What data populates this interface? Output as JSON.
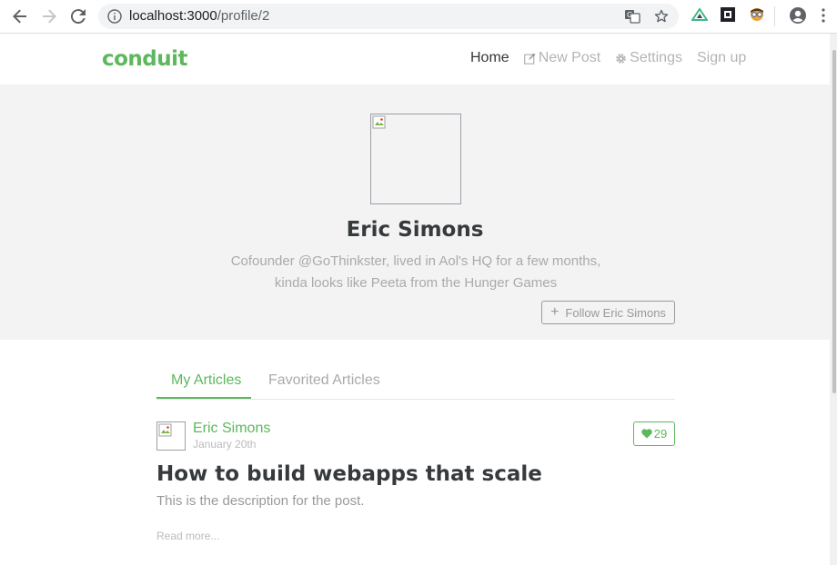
{
  "browser": {
    "url_host": "localhost:3000",
    "url_path": "/profile/2"
  },
  "navbar": {
    "brand": "conduit",
    "links": [
      {
        "label": "Home",
        "icon": ""
      },
      {
        "label": "New Post",
        "icon": "edit-icon"
      },
      {
        "label": "Settings",
        "icon": "gear-icon"
      },
      {
        "label": "Sign up",
        "icon": ""
      }
    ]
  },
  "profile": {
    "name": "Eric Simons",
    "bio": "Cofounder @GoThinkster, lived in Aol's HQ for a few months, kinda looks like Peeta from the Hunger Games",
    "follow_label": "Follow Eric Simons"
  },
  "tabs": [
    {
      "label": "My Articles",
      "active": true
    },
    {
      "label": "Favorited Articles",
      "active": false
    }
  ],
  "article": {
    "author": "Eric Simons",
    "date": "January 20th",
    "likes": "29",
    "title": "How to build webapps that scale",
    "description": "This is the description for the post.",
    "read_more": "Read more..."
  },
  "colors": {
    "brand": "#5cb85c",
    "banner_bg": "#f3f3f3"
  }
}
